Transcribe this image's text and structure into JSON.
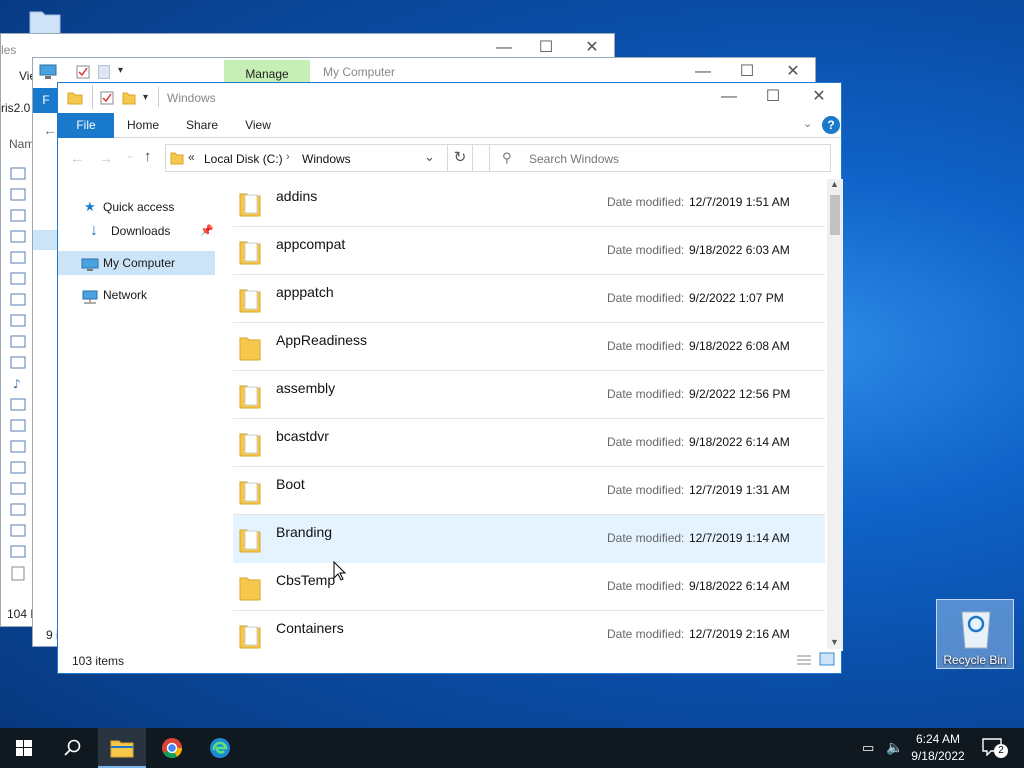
{
  "desktop": {
    "recycle_bin_label": "Recycle Bin"
  },
  "back_window_1": {
    "title_fragment": "les",
    "view_fragment": "Vie",
    "path_fragment": "ris2.0",
    "name_col_fragment": "Nam",
    "status_fragment": "104 N"
  },
  "back_window_2": {
    "manage_tab": "Manage",
    "title": "My Computer",
    "file_fragment": "F",
    "status_fragment": "9 i"
  },
  "main_window": {
    "title": "Windows",
    "tabs": [
      "File",
      "Home",
      "Share",
      "View"
    ],
    "address": {
      "chevron": "«",
      "segments": [
        "Local Disk (C:)",
        "Windows"
      ]
    },
    "search_placeholder": "Search Windows",
    "nav": {
      "quick_access": "Quick access",
      "downloads": "Downloads",
      "my_computer": "My Computer",
      "network": "Network"
    },
    "date_label": "Date modified:",
    "items": [
      {
        "name": "addins",
        "date": "12/7/2019 1:51 AM"
      },
      {
        "name": "appcompat",
        "date": "9/18/2022 6:03 AM"
      },
      {
        "name": "apppatch",
        "date": "9/2/2022 1:07 PM"
      },
      {
        "name": "AppReadiness",
        "date": "9/18/2022 6:08 AM"
      },
      {
        "name": "assembly",
        "date": "9/2/2022 12:56 PM"
      },
      {
        "name": "bcastdvr",
        "date": "9/18/2022 6:14 AM"
      },
      {
        "name": "Boot",
        "date": "12/7/2019 1:31 AM"
      },
      {
        "name": "Branding",
        "date": "12/7/2019 1:14 AM"
      },
      {
        "name": "CbsTemp",
        "date": "9/18/2022 6:14 AM"
      },
      {
        "name": "Containers",
        "date": "12/7/2019 2:16 AM"
      }
    ],
    "status": "103 items"
  },
  "taskbar": {
    "time": "6:24 AM",
    "date": "9/18/2022",
    "notification_count": "2"
  },
  "colors": {
    "accent": "#1979ca",
    "selection": "#cce4f7",
    "hover": "#e5f3ff",
    "folder": "#f5c74a",
    "manage_tab": "#c6efb6"
  }
}
